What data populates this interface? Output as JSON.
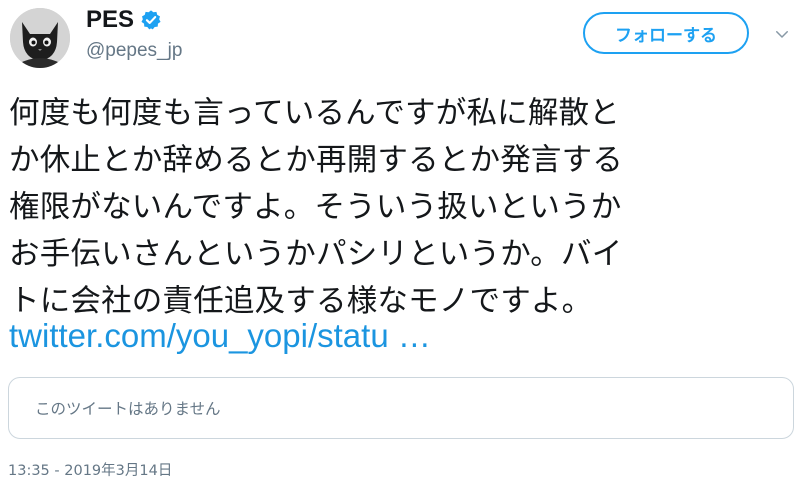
{
  "user": {
    "display_name": "PES",
    "handle": "@pepes_jp",
    "verified": true,
    "avatar_icon": "black-cat-avatar"
  },
  "header": {
    "follow_label": "フォローする",
    "more_icon": "chevron-down-icon"
  },
  "tweet": {
    "lines": [
      "何度も何度も言っているんですが私に解散と",
      "か休止とか辞めるとか再開するとか発言する",
      "権限がないんですよ。そういう扱いというか",
      "お手伝いさんというかパシリというか。バイ",
      "トに会社の責任追及する様なモノですよ。"
    ],
    "link_text": "twitter.com/you_yopi/statu …",
    "quote_unavailable": "このツイートはありません",
    "timestamp": "13:35 - 2019年3月14日"
  },
  "colors": {
    "accent": "#1da1f2",
    "link": "#1b95e0",
    "muted": "#657786",
    "text": "#14171a",
    "border": "#ccd6dd"
  }
}
